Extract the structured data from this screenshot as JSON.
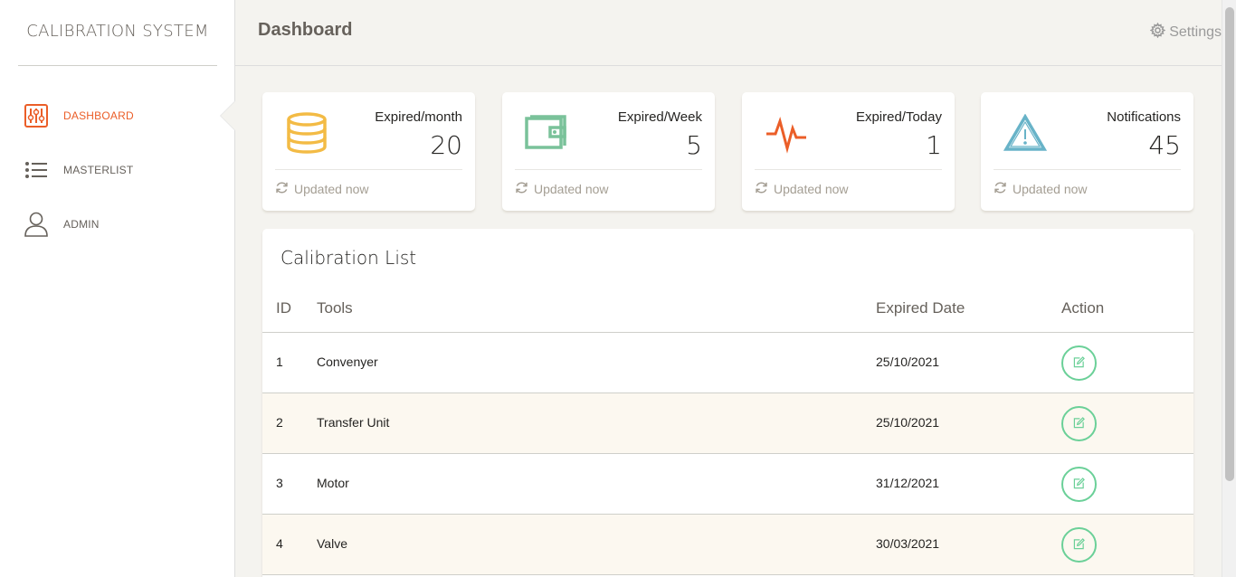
{
  "app": {
    "title": "CALIBRATION SYSTEM"
  },
  "sidebar": {
    "items": [
      {
        "label": "DASHBOARD",
        "icon": "sliders-icon",
        "active": true
      },
      {
        "label": "MASTERLIST",
        "icon": "list-icon",
        "active": false
      },
      {
        "label": "ADMIN",
        "icon": "user-icon",
        "active": false
      }
    ]
  },
  "header": {
    "title": "Dashboard",
    "settings_label": "Settings",
    "settings_icon": "gear-icon"
  },
  "stats": [
    {
      "title": "Expired/month",
      "value": "20",
      "footer": "Updated now",
      "icon": "database-icon",
      "color": "#f3bb45"
    },
    {
      "title": "Expired/Week",
      "value": "5",
      "footer": "Updated now",
      "icon": "wallet-icon",
      "color": "#7ac29a"
    },
    {
      "title": "Expired/Today",
      "value": "1",
      "footer": "Updated now",
      "icon": "pulse-icon",
      "color": "#eb5e28"
    },
    {
      "title": "Notifications",
      "value": "45",
      "footer": "Updated now",
      "icon": "warning-icon",
      "color": "#68b3c8"
    }
  ],
  "table": {
    "title": "Calibration List",
    "columns": [
      "ID",
      "Tools",
      "Expired Date",
      "Action"
    ],
    "rows": [
      {
        "id": "1",
        "tool": "Convenyer",
        "date": "25/10/2021"
      },
      {
        "id": "2",
        "tool": "Transfer Unit",
        "date": "25/10/2021"
      },
      {
        "id": "3",
        "tool": "Motor",
        "date": "31/12/2021"
      },
      {
        "id": "4",
        "tool": "Valve",
        "date": "30/03/2021"
      }
    ],
    "action_icon": "edit-icon"
  },
  "colors": {
    "accent": "#eb5e28",
    "success": "#7ac29a",
    "warning": "#f3bb45",
    "info": "#68b3c8"
  }
}
